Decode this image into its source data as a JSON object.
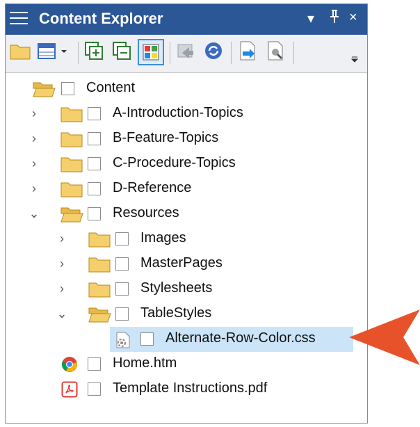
{
  "panel": {
    "title": "Content Explorer",
    "buttons": {
      "dropdown": "▾",
      "pin": "ꟼ",
      "close": "×"
    }
  },
  "toolbar": {
    "tools": [
      {
        "name": "open-folder-tool-icon"
      },
      {
        "name": "table-view-tool-icon"
      },
      {
        "name": "expand-all-tool-icon"
      },
      {
        "name": "collapse-all-tool-icon"
      },
      {
        "name": "tile-view-tool-icon",
        "selected": true
      },
      {
        "name": "send-tool-icon"
      },
      {
        "name": "refresh-tool-icon"
      },
      {
        "name": "open-tool-icon"
      },
      {
        "name": "properties-tool-icon"
      }
    ]
  },
  "tree": {
    "root": "Content",
    "items": [
      {
        "label": "A-Introduction-Topics"
      },
      {
        "label": "B-Feature-Topics"
      },
      {
        "label": "C-Procedure-Topics"
      },
      {
        "label": "D-Reference"
      },
      {
        "label": "Resources"
      },
      {
        "label": "Images"
      },
      {
        "label": "MasterPages"
      },
      {
        "label": "Stylesheets"
      },
      {
        "label": "TableStyles"
      },
      {
        "label": "Alternate-Row-Color.css"
      },
      {
        "label": "Home.htm"
      },
      {
        "label": "Template Instructions.pdf"
      }
    ]
  },
  "colors": {
    "titlebar": "#2b5797",
    "selection": "#cce4f7",
    "callout_arrow": "#e8522a"
  }
}
